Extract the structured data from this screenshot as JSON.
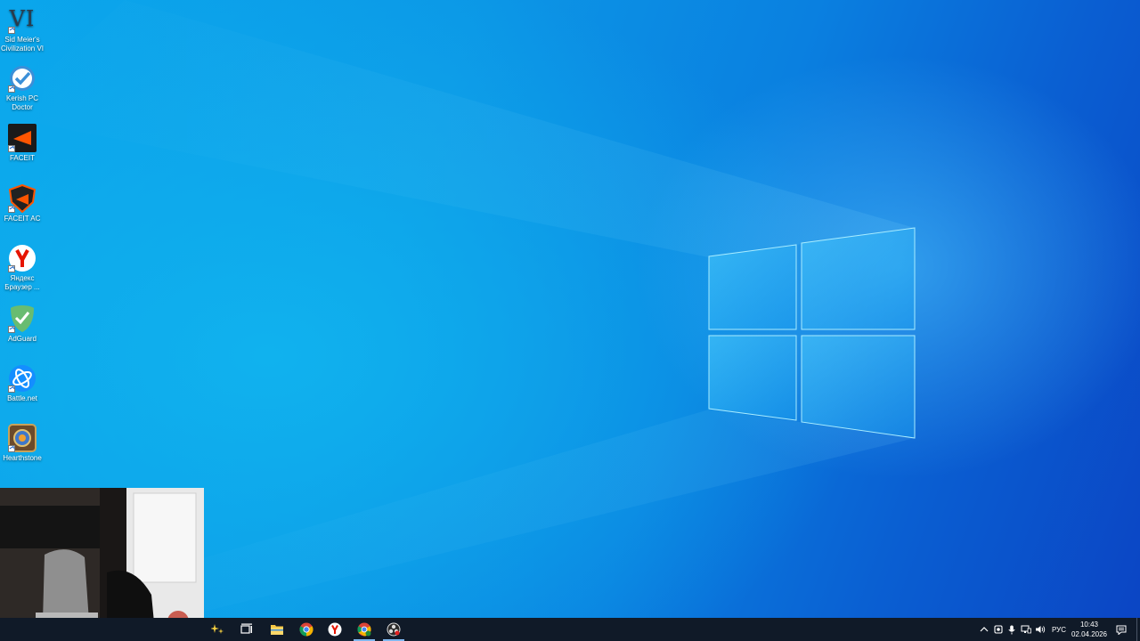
{
  "desktop": {
    "icons": [
      {
        "label": "Sid Meier's Civilization VI",
        "logo_text": "VI",
        "icon": "civilization-icon"
      },
      {
        "label": "Kerish PC Doctor",
        "icon": "kerish-doctor-icon"
      },
      {
        "label": "FACEIT",
        "icon": "faceit-icon"
      },
      {
        "label": "FACEIT AC",
        "icon": "faceit-ac-icon"
      },
      {
        "label": "Яндекс Браузер ...",
        "icon": "yandex-browser-icon"
      },
      {
        "label": "AdGuard",
        "icon": "adguard-icon"
      },
      {
        "label": "Battle.net",
        "icon": "battlenet-icon"
      },
      {
        "label": "Hearthstone",
        "icon": "hearthstone-icon"
      }
    ]
  },
  "taskbar": {
    "pinned": [
      {
        "icon": "task-view-icon"
      },
      {
        "icon": "file-explorer-icon"
      },
      {
        "icon": "chrome-icon"
      },
      {
        "icon": "yandex-browser-icon"
      },
      {
        "icon": "chrome-app-icon"
      },
      {
        "icon": "obs-icon"
      }
    ],
    "tray": {
      "language": "РУС",
      "time": "10:43",
      "date": "02.04.2026"
    }
  },
  "colors": {
    "taskbar_bg": "#101a28",
    "accent": "#7fb7ef",
    "wallpaper_light": "#0aa6ec",
    "wallpaper_dark": "#0b45c4"
  }
}
